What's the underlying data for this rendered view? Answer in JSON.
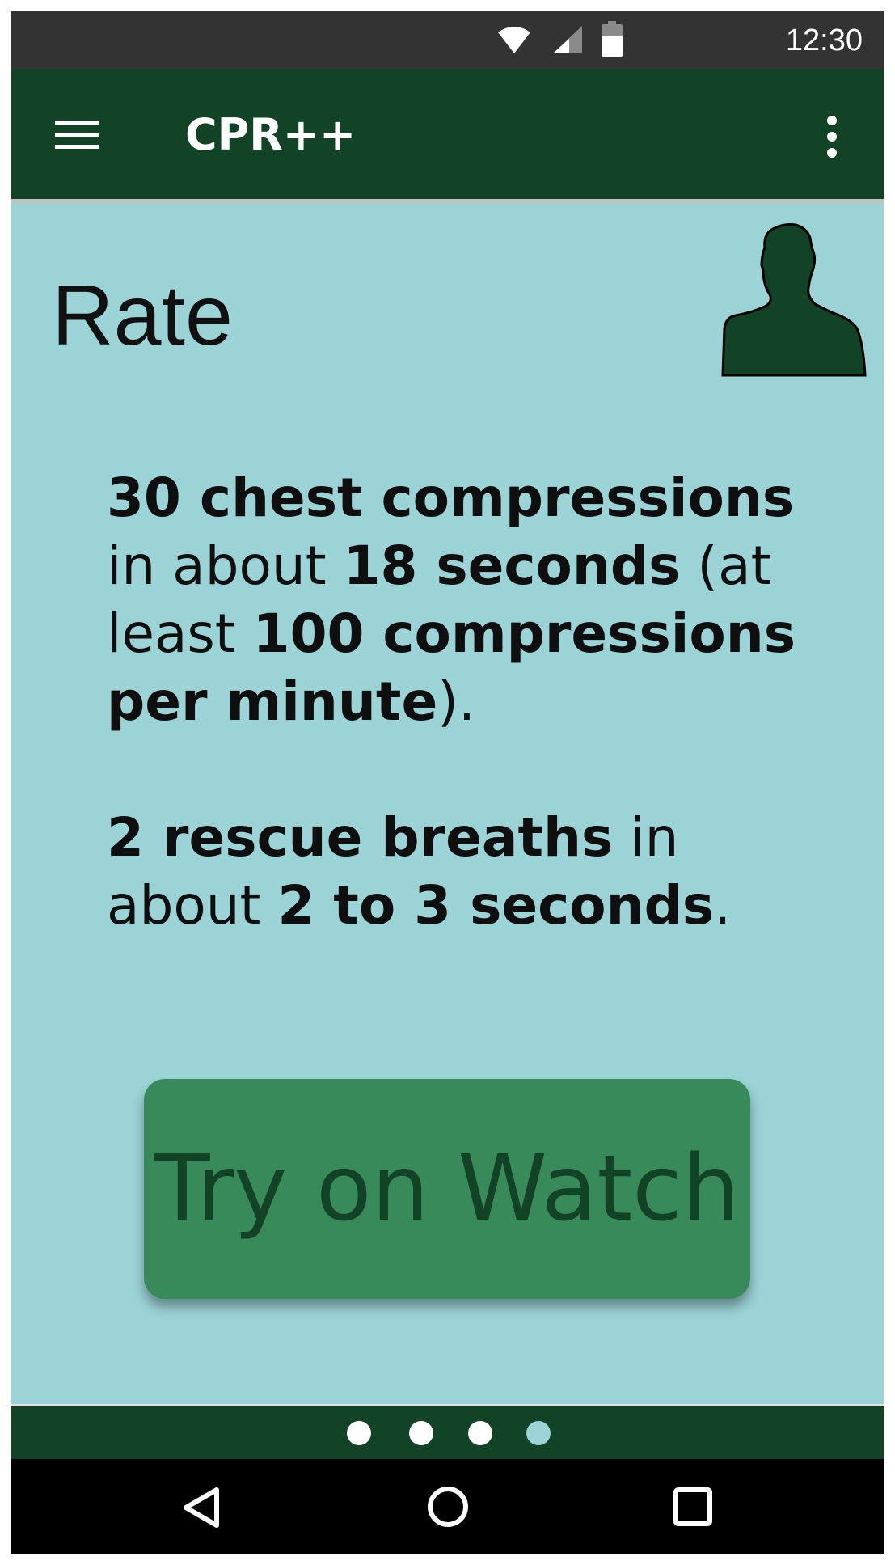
{
  "status_bar": {
    "time": "12:30",
    "icons": [
      "wifi-icon",
      "cell-signal-icon",
      "battery-icon"
    ]
  },
  "app_bar": {
    "title": "CPR++",
    "menu_icon": "hamburger-menu-icon",
    "overflow_icon": "more-vertical-icon"
  },
  "content": {
    "heading": "Rate",
    "avatar_icon": "person-silhouette-icon",
    "paragraph1": {
      "bold1": "30 chest compressions",
      "text1": " in about ",
      "bold2": "18 seconds",
      "text2": " (at least ",
      "bold3": "100 compressions per minute",
      "text3": ")."
    },
    "paragraph2": {
      "bold1": "2 rescue breaths",
      "text1": " in about ",
      "bold2": "2 to 3 seconds",
      "text2": "."
    },
    "button_label": "Try on Watch"
  },
  "pager": {
    "page_count": 4,
    "active_index": 3
  },
  "nav_bar": {
    "icons": [
      "back-icon",
      "home-icon",
      "recents-icon"
    ]
  },
  "colors": {
    "app_bar": "#124326",
    "background": "#9bd3d6",
    "button": "#388a5a",
    "button_text": "#124326",
    "status_bar": "#333333"
  }
}
